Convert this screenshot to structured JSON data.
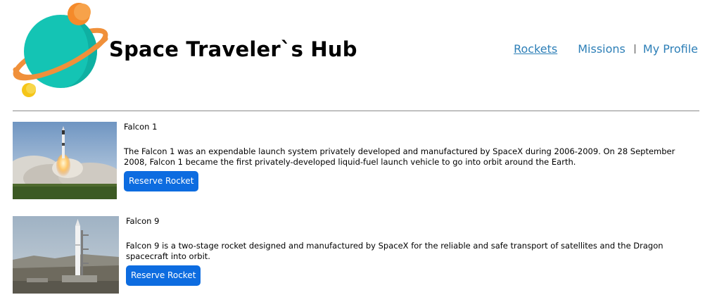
{
  "header": {
    "title": "Space Traveler`s Hub",
    "logo_icon": "planet-logo-icon"
  },
  "nav": {
    "items": [
      {
        "label": "Rockets",
        "active": true
      },
      {
        "label": "Missions",
        "active": false
      },
      {
        "label": "My Profile",
        "active": false
      }
    ],
    "link_color": "#2d7fb7"
  },
  "rockets": [
    {
      "name": "Falcon 1",
      "description": "The Falcon 1 was an expendable launch system privately developed and manufactured by SpaceX during 2006-2009. On 28 September 2008, Falcon 1 became the first privately-developed liquid-fuel launch vehicle to go into orbit around the Earth.",
      "button_label": "Reserve Rocket",
      "image": "falcon1-launch-photo"
    },
    {
      "name": "Falcon 9",
      "description": "Falcon 9 is a two-stage rocket designed and manufactured by SpaceX for the reliable and safe transport of satellites and the Dragon spacecraft into orbit.",
      "button_label": "Reserve Rocket",
      "image": "falcon9-pad-photo"
    }
  ],
  "colors": {
    "button": "#0d6ce0",
    "logo_planet": "#14c4b4",
    "logo_ring": "#f0903a",
    "logo_moon": "#f58a2a",
    "logo_small_moon": "#f5c518"
  }
}
